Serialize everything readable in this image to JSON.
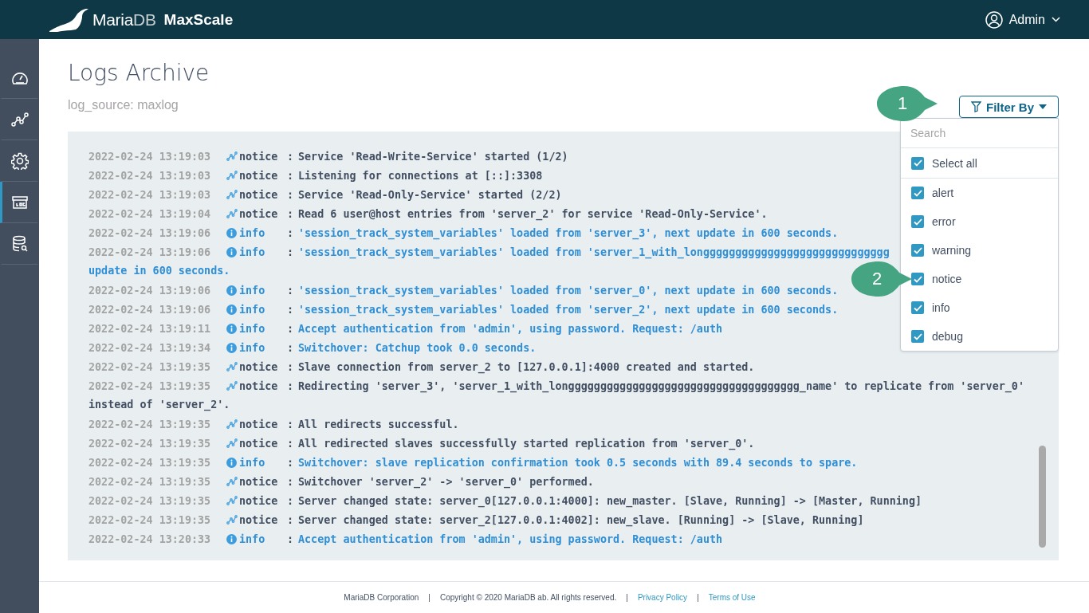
{
  "header": {
    "brand": "Maria",
    "brand_light": "DB",
    "product": "MaxScale",
    "user": "Admin"
  },
  "sidebar": {
    "items": [
      {
        "kind": "dashboard",
        "selected": false
      },
      {
        "kind": "visualization",
        "selected": false
      },
      {
        "kind": "settings",
        "selected": false
      },
      {
        "kind": "logs",
        "selected": true
      },
      {
        "kind": "query",
        "selected": false
      }
    ]
  },
  "page": {
    "title": "Logs Archive",
    "subtitle": "log_source: maxlog"
  },
  "filter": {
    "button": "Filter By",
    "search_placeholder": "Search",
    "select_all": {
      "label": "Select all",
      "checked": true
    },
    "options": [
      {
        "label": "alert",
        "checked": true
      },
      {
        "label": "error",
        "checked": true
      },
      {
        "label": "warning",
        "checked": true
      },
      {
        "label": "notice",
        "checked": true
      },
      {
        "label": "info",
        "checked": true
      },
      {
        "label": "debug",
        "checked": true
      }
    ]
  },
  "callouts": [
    {
      "number": "1"
    },
    {
      "number": "2"
    }
  ],
  "log": {
    "rows": [
      {
        "time": "2022-02-24 13:19:03",
        "kind": "notice",
        "level": "notice",
        "sep": ":",
        "message": "Service 'Read-Write-Service' started (1/2)"
      },
      {
        "time": "2022-02-24 13:19:03",
        "kind": "notice",
        "level": "notice",
        "sep": ":",
        "message": "Listening for connections at [::]:3308"
      },
      {
        "time": "2022-02-24 13:19:03",
        "kind": "notice",
        "level": "notice",
        "sep": ":",
        "message": "Service 'Read-Only-Service' started (2/2)"
      },
      {
        "time": "2022-02-24 13:19:04",
        "kind": "notice",
        "level": "notice",
        "sep": ":",
        "message": "Read 6 user@host entries from 'server_2' for service 'Read-Only-Service'."
      },
      {
        "time": "2022-02-24 13:19:06",
        "kind": "info",
        "level": "info",
        "sep": ":",
        "message": "'session_track_system_variables' loaded from 'server_3', next update in 600 seconds."
      },
      {
        "time": "2022-02-24 13:19:06",
        "kind": "info",
        "level": "info",
        "sep": ":",
        "message": "'session_track_system_variables' loaded from 'server_1_with_longgggggggggggggggggggggggggggg",
        "continuation": "update in 600 seconds."
      },
      {
        "time": "2022-02-24 13:19:06",
        "kind": "info",
        "level": "info",
        "sep": ":",
        "message": "'session_track_system_variables' loaded from 'server_0', next update in 600 seconds."
      },
      {
        "time": "2022-02-24 13:19:06",
        "kind": "info",
        "level": "info",
        "sep": ":",
        "message": "'session_track_system_variables' loaded from 'server_2', next update in 600 seconds."
      },
      {
        "time": "2022-02-24 13:19:11",
        "kind": "info",
        "level": "info",
        "sep": ":",
        "message": "Accept authentication from 'admin', using password. Request: /auth"
      },
      {
        "time": "2022-02-24 13:19:34",
        "kind": "info",
        "level": "info",
        "sep": ":",
        "message": "Switchover: Catchup took 0.0 seconds."
      },
      {
        "time": "2022-02-24 13:19:35",
        "kind": "notice",
        "level": "notice",
        "sep": ":",
        "message": "Slave connection from server_2 to [127.0.0.1]:4000 created and started."
      },
      {
        "time": "2022-02-24 13:19:35",
        "kind": "notice",
        "level": "notice",
        "sep": ":",
        "message": "Redirecting 'server_3', 'server_1_with_longggggggggggggggggggggggggggggggggggg_name' to replicate from 'server_0'",
        "continuation": "instead of 'server_2'."
      },
      {
        "time": "2022-02-24 13:19:35",
        "kind": "notice",
        "level": "notice",
        "sep": ":",
        "message": "All redirects successful."
      },
      {
        "time": "2022-02-24 13:19:35",
        "kind": "notice",
        "level": "notice",
        "sep": ":",
        "message": "All redirected slaves successfully started replication from 'server_0'."
      },
      {
        "time": "2022-02-24 13:19:35",
        "kind": "info",
        "level": "info",
        "sep": ":",
        "message": "Switchover: slave replication confirmation took 0.5 seconds with 89.4 seconds to spare."
      },
      {
        "time": "2022-02-24 13:19:35",
        "kind": "notice",
        "level": "notice",
        "sep": ":",
        "message": "Switchover 'server_2' -> 'server_0' performed."
      },
      {
        "time": "2022-02-24 13:19:35",
        "kind": "notice",
        "level": "notice",
        "sep": ":",
        "message": "Server changed state: server_0[127.0.0.1:4000]: new_master. [Slave, Running] -> [Master, Running]"
      },
      {
        "time": "2022-02-24 13:19:35",
        "kind": "notice",
        "level": "notice",
        "sep": ":",
        "message": "Server changed state: server_2[127.0.0.1:4002]: new_slave. [Running] -> [Slave, Running]"
      },
      {
        "time": "2022-02-24 13:20:33",
        "kind": "info",
        "level": "info",
        "sep": ":",
        "message": "Accept authentication from 'admin', using password. Request: /auth"
      }
    ]
  },
  "footer": {
    "items": [
      {
        "kind": "text",
        "label": "MariaDB Corporation"
      },
      {
        "kind": "text",
        "label": "Copyright © 2020 MariaDB ab. All rights reserved."
      },
      {
        "kind": "link",
        "label": "Privacy Policy"
      },
      {
        "kind": "link",
        "label": "Terms of Use"
      }
    ],
    "separator": "|"
  }
}
